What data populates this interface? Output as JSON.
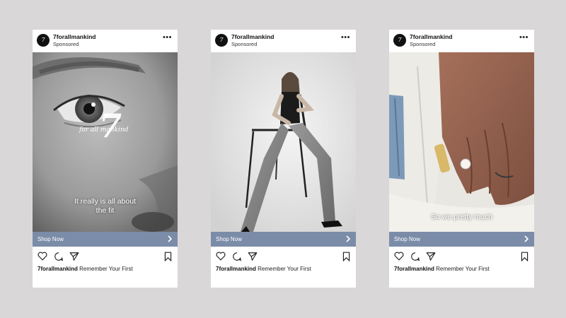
{
  "posts": [
    {
      "account": "7forallmankind",
      "sponsored": "Sponsored",
      "avatar_text": "7",
      "overlay_text_line1": "It really is all about",
      "overlay_text_line2": "the fit",
      "logo_mark": "7",
      "logo_script": "for all mankind",
      "cta": "Shop Now",
      "caption_account": "7forallmankind",
      "caption_text": "Remember Your First"
    },
    {
      "account": "7forallmankind",
      "sponsored": "Sponsored",
      "avatar_text": "7",
      "cta": "Shop Now",
      "caption_account": "7forallmankind",
      "caption_text": "Remember Your First"
    },
    {
      "account": "7forallmankind",
      "sponsored": "Sponsored",
      "avatar_text": "7",
      "overlay_text_line1": "So we pretty much",
      "cta": "Shop Now",
      "caption_account": "7forallmankind",
      "caption_text": "Remember Your First"
    }
  ],
  "colors": {
    "background": "#d9d7d8",
    "cta": "#7b8ca8",
    "card": "#ffffff"
  },
  "icons": [
    "more-icon",
    "heart-icon",
    "comment-icon",
    "share-icon",
    "bookmark-icon",
    "chevron-right-icon"
  ]
}
